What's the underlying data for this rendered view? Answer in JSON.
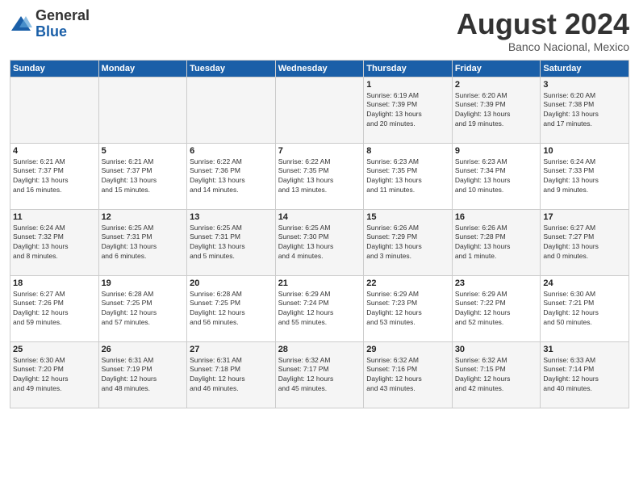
{
  "logo": {
    "general": "General",
    "blue": "Blue"
  },
  "header": {
    "month_year": "August 2024",
    "location": "Banco Nacional, Mexico"
  },
  "weekdays": [
    "Sunday",
    "Monday",
    "Tuesday",
    "Wednesday",
    "Thursday",
    "Friday",
    "Saturday"
  ],
  "weeks": [
    [
      {
        "day": "",
        "info": ""
      },
      {
        "day": "",
        "info": ""
      },
      {
        "day": "",
        "info": ""
      },
      {
        "day": "",
        "info": ""
      },
      {
        "day": "1",
        "info": "Sunrise: 6:19 AM\nSunset: 7:39 PM\nDaylight: 13 hours\nand 20 minutes."
      },
      {
        "day": "2",
        "info": "Sunrise: 6:20 AM\nSunset: 7:39 PM\nDaylight: 13 hours\nand 19 minutes."
      },
      {
        "day": "3",
        "info": "Sunrise: 6:20 AM\nSunset: 7:38 PM\nDaylight: 13 hours\nand 17 minutes."
      }
    ],
    [
      {
        "day": "4",
        "info": "Sunrise: 6:21 AM\nSunset: 7:37 PM\nDaylight: 13 hours\nand 16 minutes."
      },
      {
        "day": "5",
        "info": "Sunrise: 6:21 AM\nSunset: 7:37 PM\nDaylight: 13 hours\nand 15 minutes."
      },
      {
        "day": "6",
        "info": "Sunrise: 6:22 AM\nSunset: 7:36 PM\nDaylight: 13 hours\nand 14 minutes."
      },
      {
        "day": "7",
        "info": "Sunrise: 6:22 AM\nSunset: 7:35 PM\nDaylight: 13 hours\nand 13 minutes."
      },
      {
        "day": "8",
        "info": "Sunrise: 6:23 AM\nSunset: 7:35 PM\nDaylight: 13 hours\nand 11 minutes."
      },
      {
        "day": "9",
        "info": "Sunrise: 6:23 AM\nSunset: 7:34 PM\nDaylight: 13 hours\nand 10 minutes."
      },
      {
        "day": "10",
        "info": "Sunrise: 6:24 AM\nSunset: 7:33 PM\nDaylight: 13 hours\nand 9 minutes."
      }
    ],
    [
      {
        "day": "11",
        "info": "Sunrise: 6:24 AM\nSunset: 7:32 PM\nDaylight: 13 hours\nand 8 minutes."
      },
      {
        "day": "12",
        "info": "Sunrise: 6:25 AM\nSunset: 7:31 PM\nDaylight: 13 hours\nand 6 minutes."
      },
      {
        "day": "13",
        "info": "Sunrise: 6:25 AM\nSunset: 7:31 PM\nDaylight: 13 hours\nand 5 minutes."
      },
      {
        "day": "14",
        "info": "Sunrise: 6:25 AM\nSunset: 7:30 PM\nDaylight: 13 hours\nand 4 minutes."
      },
      {
        "day": "15",
        "info": "Sunrise: 6:26 AM\nSunset: 7:29 PM\nDaylight: 13 hours\nand 3 minutes."
      },
      {
        "day": "16",
        "info": "Sunrise: 6:26 AM\nSunset: 7:28 PM\nDaylight: 13 hours\nand 1 minute."
      },
      {
        "day": "17",
        "info": "Sunrise: 6:27 AM\nSunset: 7:27 PM\nDaylight: 13 hours\nand 0 minutes."
      }
    ],
    [
      {
        "day": "18",
        "info": "Sunrise: 6:27 AM\nSunset: 7:26 PM\nDaylight: 12 hours\nand 59 minutes."
      },
      {
        "day": "19",
        "info": "Sunrise: 6:28 AM\nSunset: 7:25 PM\nDaylight: 12 hours\nand 57 minutes."
      },
      {
        "day": "20",
        "info": "Sunrise: 6:28 AM\nSunset: 7:25 PM\nDaylight: 12 hours\nand 56 minutes."
      },
      {
        "day": "21",
        "info": "Sunrise: 6:29 AM\nSunset: 7:24 PM\nDaylight: 12 hours\nand 55 minutes."
      },
      {
        "day": "22",
        "info": "Sunrise: 6:29 AM\nSunset: 7:23 PM\nDaylight: 12 hours\nand 53 minutes."
      },
      {
        "day": "23",
        "info": "Sunrise: 6:29 AM\nSunset: 7:22 PM\nDaylight: 12 hours\nand 52 minutes."
      },
      {
        "day": "24",
        "info": "Sunrise: 6:30 AM\nSunset: 7:21 PM\nDaylight: 12 hours\nand 50 minutes."
      }
    ],
    [
      {
        "day": "25",
        "info": "Sunrise: 6:30 AM\nSunset: 7:20 PM\nDaylight: 12 hours\nand 49 minutes."
      },
      {
        "day": "26",
        "info": "Sunrise: 6:31 AM\nSunset: 7:19 PM\nDaylight: 12 hours\nand 48 minutes."
      },
      {
        "day": "27",
        "info": "Sunrise: 6:31 AM\nSunset: 7:18 PM\nDaylight: 12 hours\nand 46 minutes."
      },
      {
        "day": "28",
        "info": "Sunrise: 6:32 AM\nSunset: 7:17 PM\nDaylight: 12 hours\nand 45 minutes."
      },
      {
        "day": "29",
        "info": "Sunrise: 6:32 AM\nSunset: 7:16 PM\nDaylight: 12 hours\nand 43 minutes."
      },
      {
        "day": "30",
        "info": "Sunrise: 6:32 AM\nSunset: 7:15 PM\nDaylight: 12 hours\nand 42 minutes."
      },
      {
        "day": "31",
        "info": "Sunrise: 6:33 AM\nSunset: 7:14 PM\nDaylight: 12 hours\nand 40 minutes."
      }
    ]
  ]
}
